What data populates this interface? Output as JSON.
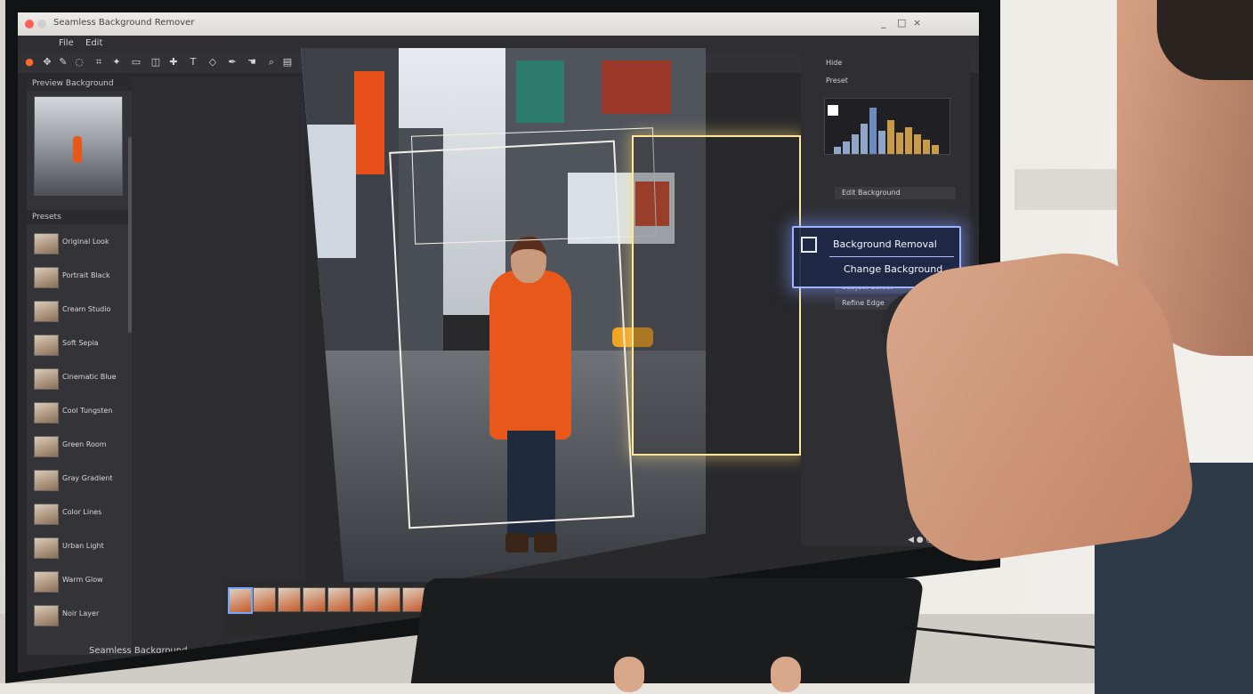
{
  "titlebar": {
    "title": "Seamless Background Remover",
    "controls": [
      "_",
      "□",
      "×"
    ]
  },
  "menubar": [
    "File",
    "Edit"
  ],
  "toolbar_icons": [
    "move-icon",
    "brush-icon",
    "lasso-icon",
    "crop-icon",
    "wand-icon",
    "eraser-icon",
    "stamp-icon",
    "heal-icon",
    "text-icon",
    "shape-icon",
    "pen-icon",
    "hand-icon",
    "zoom-icon",
    "gradient-icon",
    "eyedropper-icon",
    "layers-icon"
  ],
  "left_panel": {
    "preview_header": "Preview  Background",
    "layers_header": "Presets",
    "layers": [
      "Original Look",
      "Portrait Black",
      "Cream Studio",
      "Soft Sepia",
      "Cinematic Blue",
      "Cool Tungsten",
      "Green Room",
      "Gray Gradient",
      "Color Lines",
      "Urban Light",
      "Warm Glow",
      "Noir Layer"
    ]
  },
  "filmstrip": {
    "count": 13,
    "selected_index": 0,
    "bottom_label": "Seamless Background..."
  },
  "right_panel": {
    "top_title": "Hide",
    "panel_title": "Preset",
    "section_title": "Edit Background",
    "rows": [
      "Subject Select",
      "Refine Edge"
    ],
    "status": "◀ ● ◎ 100% ▶"
  },
  "popup": {
    "item1": "Background Removal",
    "item2": "Change Background"
  },
  "colors": {
    "accent_glow": "#ffe79a",
    "popup_border": "#9fb4ff",
    "coat": "#e8581b"
  }
}
